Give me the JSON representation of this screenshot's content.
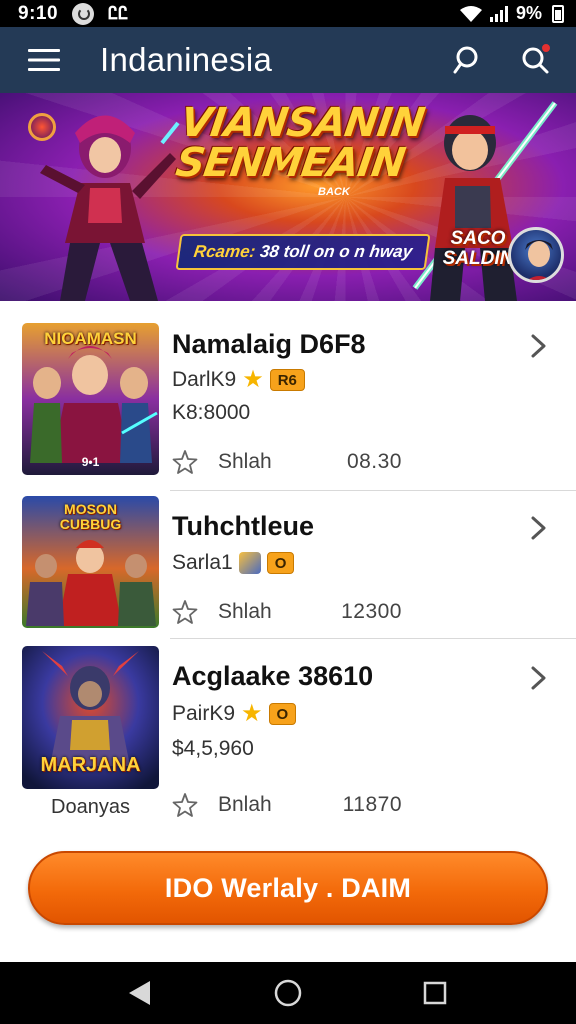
{
  "status_bar": {
    "time": "9:10",
    "carrier_glyph": "ᏝᏝ",
    "battery": "9%"
  },
  "header": {
    "title": "Indaninesia",
    "menu_icon": "menu-icon",
    "search_icon": "search-icon",
    "notification_search_icon": "search-notification-icon"
  },
  "banner": {
    "title_line1": "VIANSANIN",
    "title_line2": "SENMEAIN",
    "subtitle": "BACK",
    "promo_label": "Rcame:",
    "promo_rest": "38 toll on o n hway",
    "badge_line1": "SACO",
    "badge_line2": "SALDIN"
  },
  "items": [
    {
      "title": "Namalaig D6F8",
      "sub": "DarlK9",
      "tag": "R6",
      "price": "K8:8000",
      "meta_label": "Shlah",
      "meta_count": "08.30",
      "thumb_text": "NIOAMASN",
      "thumb_caption": "",
      "thumb_num": "9•1"
    },
    {
      "title": "Tuhchtleue",
      "sub": "Sarla1",
      "tag": "O",
      "price": "",
      "meta_label": "Shlah",
      "meta_count": "12300",
      "thumb_text": "MOSON CUBBUG",
      "thumb_caption": "",
      "thumb_num": ""
    },
    {
      "title": "Acglaake 38610",
      "sub": "PairK9",
      "tag": "O",
      "price": "$4,5,960",
      "meta_label": "Bnlah",
      "meta_count": "11870",
      "thumb_text": "MARJANA",
      "thumb_caption": "Doanyas",
      "thumb_num": ""
    }
  ],
  "cta": {
    "label": "IDO Werlaly . DAIM"
  },
  "colors": {
    "header_bg": "#243a56",
    "cta_orange": "#f36a0a",
    "star_gold": "#f7b500"
  }
}
